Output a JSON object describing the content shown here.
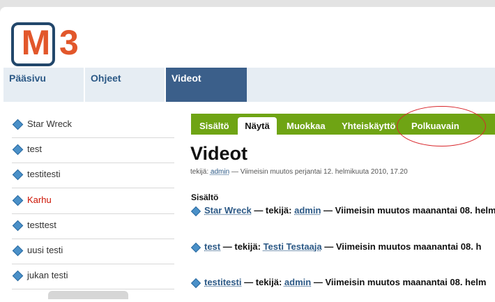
{
  "logo": {
    "letter": "M",
    "number": "3"
  },
  "nav": {
    "items": [
      "Pääsivu",
      "Ohjeet",
      "Videot"
    ],
    "active": "Videot"
  },
  "sidebar": {
    "items": [
      {
        "label": "Star Wreck",
        "red": false
      },
      {
        "label": "test",
        "red": false
      },
      {
        "label": "testitesti",
        "red": false
      },
      {
        "label": "Karhu",
        "red": true
      },
      {
        "label": "testtest",
        "red": false
      },
      {
        "label": "uusi testi",
        "red": false
      },
      {
        "label": "jukan testi",
        "red": false
      }
    ]
  },
  "tabs": {
    "items": [
      "Sisältö",
      "Näytä",
      "Muokkaa",
      "Yhteiskäyttö",
      "Polkuavain"
    ],
    "active": "Näytä"
  },
  "page": {
    "title": "Videot",
    "meta_prefix": "tekijä:",
    "meta_author": "admin",
    "meta_suffix": "— Viimeisin muutos perjantai 12. helmikuuta 2010, 17.20",
    "content_label": "Sisältö"
  },
  "entries": [
    {
      "title": "Star Wreck",
      "sep": "— tekijä:",
      "author": "admin",
      "modified": "— Viimeisin muutos maanantai 08. helm"
    },
    {
      "title": "test",
      "sep": "— tekijä:",
      "author": "Testi Testaaja",
      "modified": "— Viimeisin muutos maanantai 08. h"
    },
    {
      "title": "testitesti",
      "sep": "— tekijä:",
      "author": "admin",
      "modified": "— Viimeisin muutos maanantai 08. helm"
    }
  ],
  "colors": {
    "accent_green": "#6fa414",
    "nav_active": "#3b5f8a",
    "link": "#2c5986",
    "annotation": "#d8262b"
  }
}
